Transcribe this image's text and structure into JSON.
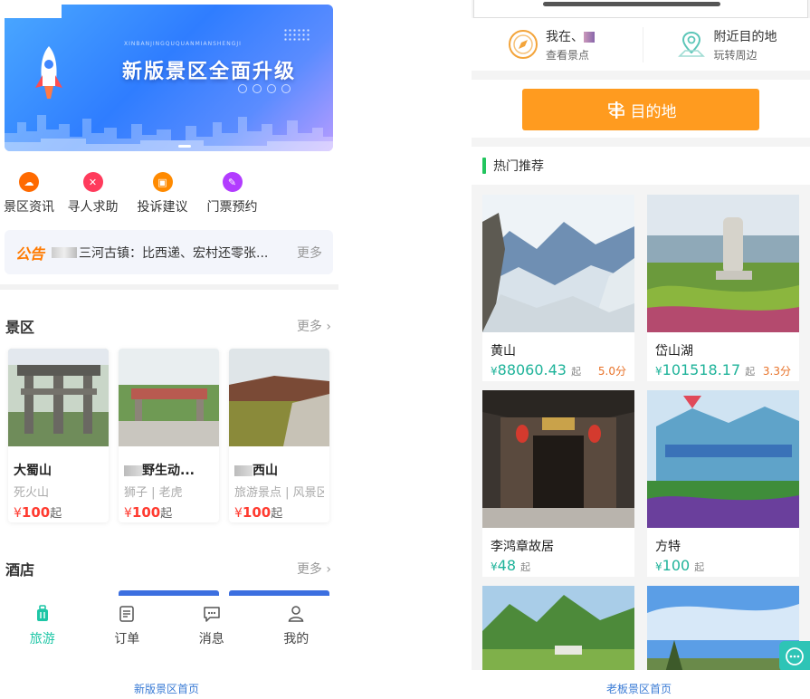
{
  "left": {
    "banner": {
      "title": "新版景区全面升级",
      "subtitle": "XINBANJINGQUQUANMIANSHENGJI"
    },
    "quick_links": [
      {
        "label": "景区资讯",
        "icon": "info-icon",
        "color": "#ff6a00"
      },
      {
        "label": "寻人求助",
        "icon": "help-icon",
        "color": "#ff3b5c"
      },
      {
        "label": "投诉建议",
        "icon": "complaint-icon",
        "color": "#ff8a00"
      },
      {
        "label": "门票预约",
        "icon": "ticket-icon",
        "color": "#b23cff"
      }
    ],
    "notice": {
      "tag": "公告",
      "text": "三河古镇：比西递、宏村还零张...",
      "more": "更多"
    },
    "scenic": {
      "title": "景区",
      "more": "更多 ›",
      "items": [
        {
          "name": "大蜀山",
          "tags": "死火山",
          "currency": "¥",
          "price": "100",
          "suffix": "起"
        },
        {
          "name": "野生动...",
          "tags": "狮子 | 老虎",
          "currency": "¥",
          "price": "100",
          "suffix": "起"
        },
        {
          "name": "西山",
          "tags": "旅游景点 | 风景区",
          "currency": "¥",
          "price": "100",
          "suffix": "起"
        }
      ]
    },
    "hotel": {
      "title": "酒店",
      "more": "更多 ›"
    },
    "tabs": [
      {
        "label": "旅游",
        "icon": "luggage-icon"
      },
      {
        "label": "订单",
        "icon": "order-icon"
      },
      {
        "label": "消息",
        "icon": "message-icon"
      },
      {
        "label": "我的",
        "icon": "user-icon"
      }
    ],
    "caption": "新版景区首页"
  },
  "right": {
    "location": [
      {
        "title": "我在、",
        "sub": "查看景点",
        "icon": "compass-icon"
      },
      {
        "title": "附近目的地",
        "sub": "玩转周边",
        "icon": "map-pin-icon"
      }
    ],
    "destination_button": "目的地",
    "hot_title": "热门推荐",
    "hot_items": [
      {
        "name": "黄山",
        "currency": "¥",
        "price": "88060.43",
        "suffix": "起",
        "score": "5.0分"
      },
      {
        "name": "岱山湖",
        "currency": "¥",
        "price": "101518.17",
        "suffix": "起",
        "score": "3.3分"
      },
      {
        "name": "李鸿章故居",
        "currency": "¥",
        "price": "48",
        "suffix": "起",
        "score": ""
      },
      {
        "name": "方特",
        "currency": "¥",
        "price": "100",
        "suffix": "起",
        "score": ""
      }
    ],
    "caption": "老板景区首页"
  },
  "colors": {
    "accent_teal": "#1ec6a6",
    "orange": "#ff9b1f",
    "price_red": "#ff3b30",
    "price_teal": "#1fb39a"
  }
}
